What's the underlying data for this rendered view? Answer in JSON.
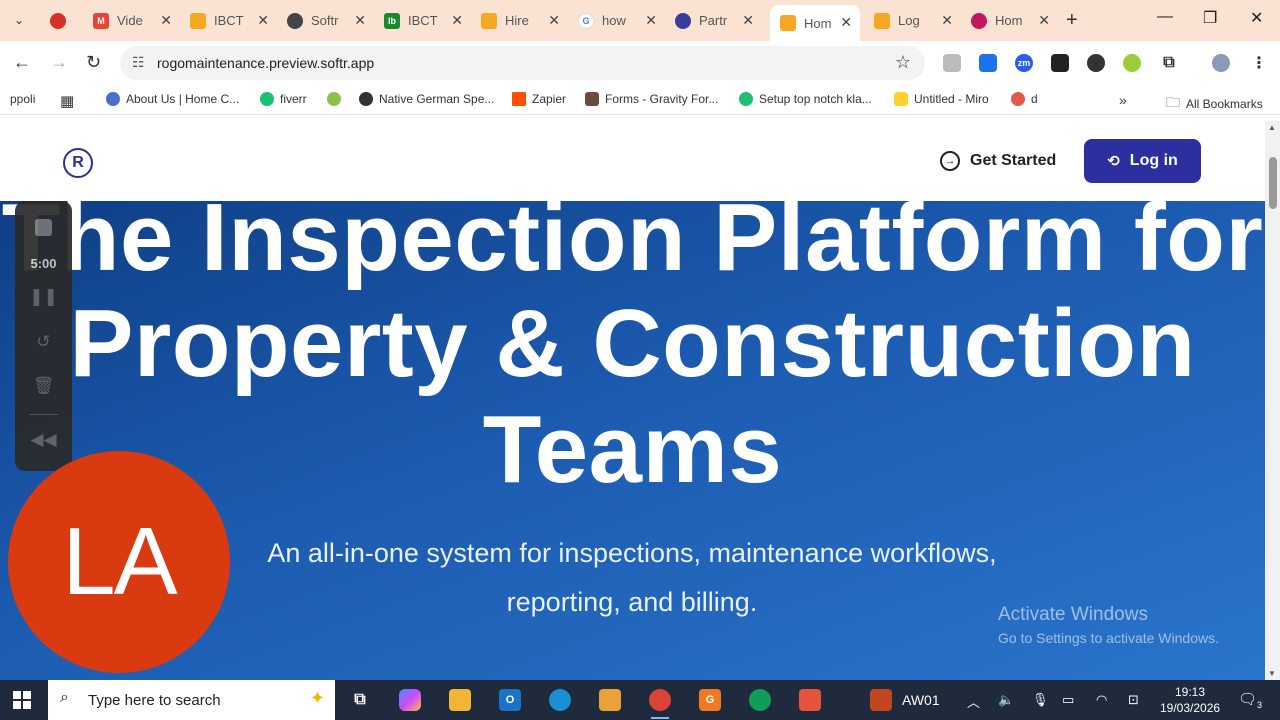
{
  "browser": {
    "tabs": [
      {
        "title": "",
        "color": "#d93025",
        "glyph": "◉"
      },
      {
        "title": "Vide",
        "color": "#ea4335",
        "glyph": "M"
      },
      {
        "title": "IBCT",
        "color": "#f6a821",
        "glyph": "▦"
      },
      {
        "title": "Softr",
        "color": "#444444",
        "glyph": "⊛"
      },
      {
        "title": "IBCT",
        "color": "#1b8a2f",
        "glyph": "Ib"
      },
      {
        "title": "Hire",
        "color": "#f6a821",
        "glyph": "▦"
      },
      {
        "title": "how",
        "color": "#4285f4",
        "glyph": "G"
      },
      {
        "title": "Partr",
        "color": "#3c3c9c",
        "glyph": "◐"
      },
      {
        "title": "Hom",
        "color": "#f6a821",
        "glyph": "▦"
      },
      {
        "title": "Log",
        "color": "#f6a821",
        "glyph": "▦"
      },
      {
        "title": "Hom",
        "color": "#c2185b",
        "glyph": "◎"
      }
    ],
    "url": "rogomaintenance.preview.softr.app",
    "bookmarks": [
      {
        "label": "ppoli",
        "color": ""
      },
      {
        "label": "About Us | Home C...",
        "color": "#4a6fd1"
      },
      {
        "label": "fiverr",
        "color": "#1dbf73"
      },
      {
        "label": "",
        "color": "#8bc34a"
      },
      {
        "label": "Native German Spe...",
        "color": "#333333"
      },
      {
        "label": "Zapier",
        "color": "#ff4f00"
      },
      {
        "label": "Forms - Gravity For...",
        "color": "#6b4b3e"
      },
      {
        "label": "Setup top notch kla...",
        "color": "#1dbf73"
      },
      {
        "label": "Untitled - Miro",
        "color": "#ffd02f"
      },
      {
        "label": "d",
        "color": "#e2594a"
      }
    ],
    "all_bookmarks": "All Bookmarks"
  },
  "site": {
    "logo_glyph": "R",
    "get_started": "Get Started",
    "login": "Log in",
    "hero_title": "The Inspection Platform for Property & Construction Teams",
    "hero_subtitle": "An all-in-one system for inspections, maintenance workflows, reporting, and billing."
  },
  "recorder": {
    "time": "5:00"
  },
  "avatar": {
    "initials": "LA",
    "color": "#d93a10"
  },
  "watermark": {
    "line1": "Activate Windows",
    "line2": "Go to Settings to activate Windows."
  },
  "taskbar": {
    "search_placeholder": "Type here to search",
    "app_label": "AW01",
    "time": "19:13",
    "date": "19/03/2026",
    "notifications": "3"
  }
}
